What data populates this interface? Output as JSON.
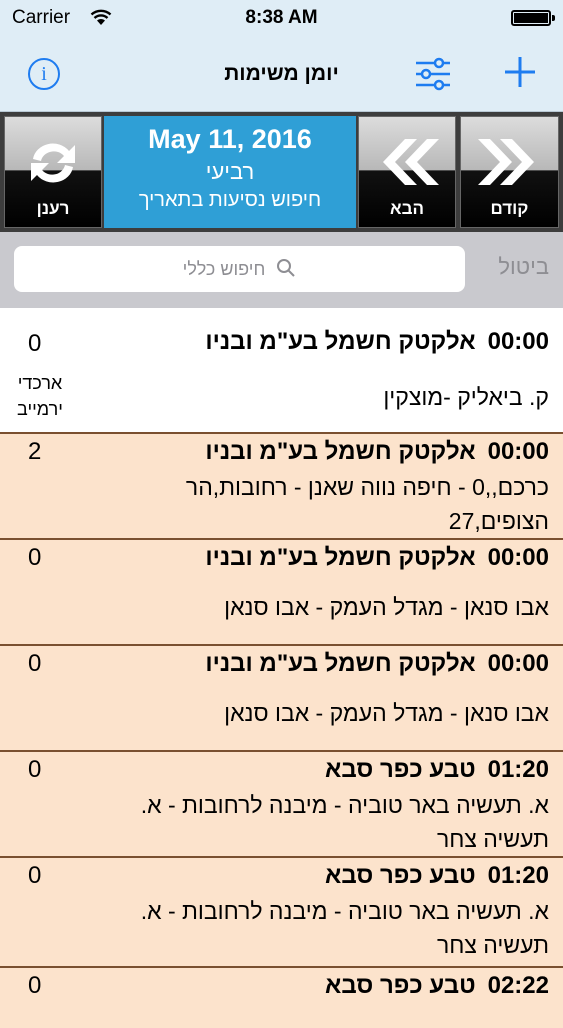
{
  "status": {
    "carrier": "Carrier",
    "time": "8:38 AM"
  },
  "nav": {
    "title": "יומן משימות",
    "info_icon": "info-icon",
    "filter_icon": "sliders-icon",
    "add_icon": "plus-icon"
  },
  "datebar": {
    "refresh_label": "רענן",
    "date": "May 11, 2016",
    "weekday": "רביעי",
    "search_by_date": "חיפוש נסיעות בתאריך",
    "next_label": "הבא",
    "prev_label": "קודם"
  },
  "search": {
    "placeholder": "חיפוש כללי",
    "cancel": "ביטול"
  },
  "colors": {
    "accent": "#1e7cf0",
    "date_blue": "#2f9fd6",
    "row_peach": "#fce3cc"
  },
  "rows": [
    {
      "time": "00:00",
      "company": "אלקטק חשמל בע\"מ ובניו",
      "desc": "ק. ביאליק -מוצקין",
      "count": "0",
      "note": "ארכדי ירמייב"
    },
    {
      "time": "00:00",
      "company": "אלקטק חשמל בע\"מ ובניו",
      "desc": "כרכם,,0 - חיפה נווה שאנן - רחובות,הר הצופים,27",
      "count": "2"
    },
    {
      "time": "00:00",
      "company": "אלקטק חשמל בע\"מ ובניו",
      "desc": "אבו סנאן - מגדל העמק - אבו סנאן",
      "count": "0"
    },
    {
      "time": "00:00",
      "company": "אלקטק חשמל בע\"מ ובניו",
      "desc": "אבו סנאן - מגדל העמק - אבו סנאן",
      "count": "0"
    },
    {
      "time": "01:20",
      "company": "טבע כפר סבא",
      "desc": "א. תעשיה באר טוביה - מיבנה לרחובות - א. תעשיה צחר",
      "count": "0"
    },
    {
      "time": "01:20",
      "company": "טבע כפר סבא",
      "desc": "א. תעשיה באר טוביה - מיבנה לרחובות - א. תעשיה צחר",
      "count": "0"
    },
    {
      "time": "02:22",
      "company": "טבע כפר סבא",
      "desc": "",
      "count": "0"
    }
  ]
}
